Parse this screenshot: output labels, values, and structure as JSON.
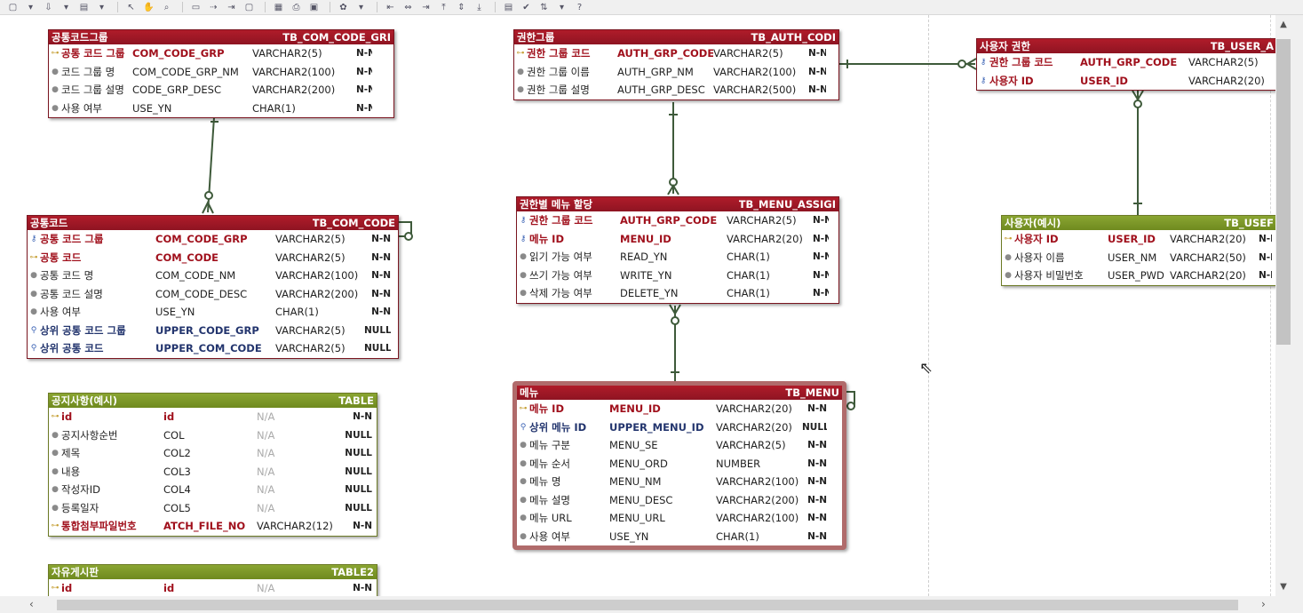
{
  "toolbar": {
    "groups": [
      [
        "new-page-icon",
        "dropdown-icon",
        "import-icon",
        "dropdown-icon",
        "open-icon",
        "dropdown-icon"
      ],
      [
        "pointer-icon",
        "hand-icon",
        "zoom-icon"
      ],
      [
        "entity-icon",
        "relation-icon",
        "relation2-icon",
        "note-icon"
      ],
      [
        "copy-image-icon",
        "print-icon",
        "image-icon"
      ],
      [
        "color-icon",
        "dropdown-icon"
      ],
      [
        "align-left-icon",
        "align-center-icon",
        "align-right-icon",
        "align-top-icon",
        "align-middle-icon",
        "align-bottom-icon"
      ],
      [
        "properties-icon",
        "validate-icon",
        "sort-icon",
        "dropdown-icon",
        "help-icon"
      ]
    ],
    "glyphs": [
      "▢",
      "▾",
      "⇩",
      "▾",
      "▤",
      "▾",
      "↖",
      "✋",
      "⌕",
      "▭",
      "⇢",
      "⇥",
      "▢",
      "▦",
      "⎙",
      "▣",
      "✿",
      "▾",
      "⇤",
      "⇔",
      "⇥",
      "⤒",
      "⇕",
      "⤓",
      "▤",
      "✔",
      "⇅",
      "▾",
      "?"
    ]
  },
  "entities": [
    {
      "id": "com-code-group",
      "color": "red",
      "logical": "공통코드그룹",
      "physical": "TB_COM_CODE_GRI",
      "cols": [
        80,
        135,
        117,
        18
      ],
      "rows": [
        {
          "kind": "pk",
          "logical": "공통 코드 그룹",
          "physical": "COM_CODE_GRP",
          "type": "VARCHAR2(5)",
          "nn": "N-N"
        },
        {
          "kind": "col",
          "logical": "코드 그룹 명",
          "physical": "COM_CODE_GRP_NM",
          "type": "VARCHAR2(100)",
          "nn": "N-N"
        },
        {
          "kind": "col",
          "logical": "코드 그룹 설명",
          "physical": "CODE_GRP_DESC",
          "type": "VARCHAR2(200)",
          "nn": "N-N"
        },
        {
          "kind": "col",
          "logical": "사용 여부",
          "physical": "USE_YN",
          "type": "CHAR(1)",
          "nn": "N-N"
        }
      ]
    },
    {
      "id": "com-code",
      "color": "red",
      "logical": "공통코드",
      "physical": "TB_COM_CODE",
      "cols": [
        130,
        135,
        100,
        30
      ],
      "rows": [
        {
          "kind": "pkfk",
          "logical": "공통 코드 그룹",
          "physical": "COM_CODE_GRP",
          "type": "VARCHAR2(5)",
          "nn": "N-N"
        },
        {
          "kind": "pk",
          "logical": "공통 코드",
          "physical": "COM_CODE",
          "type": "VARCHAR2(5)",
          "nn": "N-N"
        },
        {
          "kind": "col",
          "logical": "공통 코드 명",
          "physical": "COM_CODE_NM",
          "type": "VARCHAR2(100)",
          "nn": "N-N"
        },
        {
          "kind": "col",
          "logical": "공통 코드 설명",
          "physical": "COM_CODE_DESC",
          "type": "VARCHAR2(200)",
          "nn": "N-N"
        },
        {
          "kind": "col",
          "logical": "사용 여부",
          "physical": "USE_YN",
          "type": "CHAR(1)",
          "nn": "N-N"
        },
        {
          "kind": "fk",
          "logical": "상위 공통 코드 그룹",
          "physical": "UPPER_CODE_GRP",
          "type": "VARCHAR2(5)",
          "nn": "NULL"
        },
        {
          "kind": "fk",
          "logical": "상위 공통 코드",
          "physical": "UPPER_COM_CODE",
          "type": "VARCHAR2(5)",
          "nn": "NULL"
        }
      ]
    },
    {
      "id": "notice",
      "color": "green",
      "logical": "공지사항(예시)",
      "physical": "TABLE",
      "cols": [
        115,
        105,
        85,
        45
      ],
      "rows": [
        {
          "kind": "pk",
          "logical": "id",
          "physical": "id",
          "type": "N/A",
          "nn": "N-N"
        },
        {
          "kind": "col",
          "logical": "공지사항순번",
          "physical": "COL",
          "type": "N/A",
          "nn": "NULL"
        },
        {
          "kind": "col",
          "logical": "제목",
          "physical": "COL2",
          "type": "N/A",
          "nn": "NULL"
        },
        {
          "kind": "col",
          "logical": "내용",
          "physical": "COL3",
          "type": "N/A",
          "nn": "NULL"
        },
        {
          "kind": "col",
          "logical": "작성자ID",
          "physical": "COL4",
          "type": "N/A",
          "nn": "NULL"
        },
        {
          "kind": "col",
          "logical": "등록일자",
          "physical": "COL5",
          "type": "N/A",
          "nn": "NULL"
        },
        {
          "kind": "pk",
          "logical": "통합첨부파일번호",
          "physical": "ATCH_FILE_NO",
          "type": "VARCHAR2(12)",
          "nn": "N-N"
        }
      ]
    },
    {
      "id": "free-board",
      "color": "green",
      "logical": "자유게시판",
      "physical": "TABLE2",
      "cols": [
        115,
        105,
        85,
        45
      ],
      "rows": [
        {
          "kind": "pk",
          "logical": "id",
          "physical": "id",
          "type": "N/A",
          "nn": "N-N"
        }
      ]
    },
    {
      "id": "auth-group",
      "color": "red",
      "logical": "권한그룹",
      "physical": "TB_AUTH_CODI",
      "cols": [
        102,
        108,
        107,
        20
      ],
      "rows": [
        {
          "kind": "pk",
          "logical": "권한 그룹 코드",
          "physical": "AUTH_GRP_CODE",
          "type": "VARCHAR2(5)",
          "nn": "N-N"
        },
        {
          "kind": "col",
          "logical": "권한 그룹 이름",
          "physical": "AUTH_GRP_NM",
          "type": "VARCHAR2(100)",
          "nn": "N-N"
        },
        {
          "kind": "col",
          "logical": "권한 그룹 설명",
          "physical": "AUTH_GRP_DESC",
          "type": "VARCHAR2(500)",
          "nn": "N-N"
        }
      ]
    },
    {
      "id": "menu-assign",
      "color": "red",
      "logical": "권한별 메뉴 할당",
      "physical": "TB_MENU_ASSIGI",
      "cols": [
        102,
        120,
        97,
        18
      ],
      "rows": [
        {
          "kind": "pkfk",
          "logical": "권한 그룹 코드",
          "physical": "AUTH_GRP_CODE",
          "type": "VARCHAR2(5)",
          "nn": "N-N"
        },
        {
          "kind": "pkfk",
          "logical": "메뉴 ID",
          "physical": "MENU_ID",
          "type": "VARCHAR2(20)",
          "nn": "N-N"
        },
        {
          "kind": "col",
          "logical": "읽기 가능 여부",
          "physical": "READ_YN",
          "type": "CHAR(1)",
          "nn": "N-N"
        },
        {
          "kind": "col",
          "logical": "쓰기 가능 여부",
          "physical": "WRITE_YN",
          "type": "CHAR(1)",
          "nn": "N-N"
        },
        {
          "kind": "col",
          "logical": "삭제 가능 여부",
          "physical": "DELETE_YN",
          "type": "CHAR(1)",
          "nn": "N-N"
        }
      ]
    },
    {
      "id": "menu",
      "color": "red",
      "logical": "메뉴",
      "physical": "TB_MENU",
      "cols": [
        90,
        120,
        97,
        28
      ],
      "rows": [
        {
          "kind": "pk",
          "logical": "메뉴 ID",
          "physical": "MENU_ID",
          "type": "VARCHAR2(20)",
          "nn": "N-N"
        },
        {
          "kind": "fk",
          "logical": "상위 메뉴 ID",
          "physical": "UPPER_MENU_ID",
          "type": "VARCHAR2(20)",
          "nn": "NULL"
        },
        {
          "kind": "col",
          "logical": "메뉴 구분",
          "physical": "MENU_SE",
          "type": "VARCHAR2(5)",
          "nn": "N-N"
        },
        {
          "kind": "col",
          "logical": "메뉴 순서",
          "physical": "MENU_ORD",
          "type": "NUMBER",
          "nn": "N-N"
        },
        {
          "kind": "col",
          "logical": "메뉴 명",
          "physical": "MENU_NM",
          "type": "VARCHAR2(100)",
          "nn": "N-N"
        },
        {
          "kind": "col",
          "logical": "메뉴 설명",
          "physical": "MENU_DESC",
          "type": "VARCHAR2(200)",
          "nn": "N-N"
        },
        {
          "kind": "col",
          "logical": "메뉴 URL",
          "physical": "MENU_URL",
          "type": "VARCHAR2(100)",
          "nn": "N-N"
        },
        {
          "kind": "col",
          "logical": "사용 여부",
          "physical": "USE_YN",
          "type": "CHAR(1)",
          "nn": "N-N"
        }
      ]
    },
    {
      "id": "user-auth",
      "color": "red",
      "logical": "사용자 권한",
      "physical": "TB_USER_A",
      "cols": [
        102,
        122,
        100,
        0
      ],
      "rows": [
        {
          "kind": "pkfk",
          "logical": "권한 그룹 코드",
          "physical": "AUTH_GRP_CODE",
          "type": "VARCHAR2(5)",
          "nn": ""
        },
        {
          "kind": "pkfk",
          "logical": "사용자 ID",
          "physical": "USER_ID",
          "type": "VARCHAR2(20)",
          "nn": ""
        }
      ]
    },
    {
      "id": "user",
      "color": "green",
      "logical": "사용자(예시)",
      "physical": "TB_USEF",
      "cols": [
        105,
        70,
        100,
        15
      ],
      "rows": [
        {
          "kind": "pk",
          "logical": "사용자 ID",
          "physical": "USER_ID",
          "type": "VARCHAR2(20)",
          "nn": "N-N"
        },
        {
          "kind": "col",
          "logical": "사용자 이름",
          "physical": "USER_NM",
          "type": "VARCHAR2(50)",
          "nn": "N-N"
        },
        {
          "kind": "col",
          "logical": "사용자 비밀번호",
          "physical": "USER_PWD",
          "type": "VARCHAR2(20)",
          "nn": "N-N"
        }
      ]
    }
  ],
  "colors": {
    "entity_red": "#9e1826",
    "entity_green": "#7b9626",
    "relation_line": "#3e5a3a",
    "selection": "#b06b6b"
  }
}
